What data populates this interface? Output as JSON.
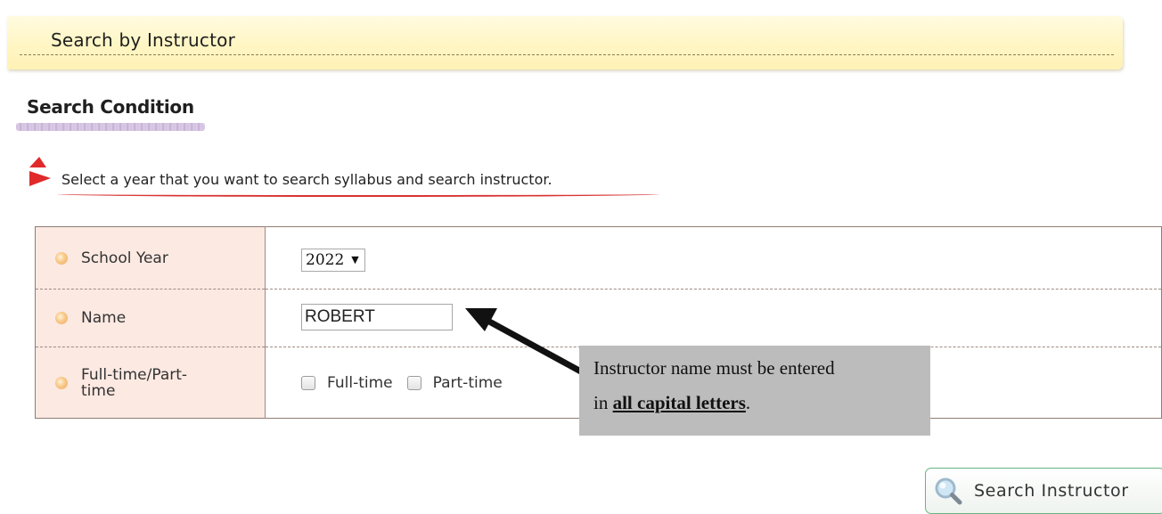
{
  "header": {
    "title": "Search by Instructor"
  },
  "section": {
    "title": "Search Condition"
  },
  "instruction": "Select a year that you want to search syllabus and search instructor.",
  "form": {
    "school_year": {
      "label": "School Year",
      "value": "2022"
    },
    "name": {
      "label": "Name",
      "value": "ROBERT"
    },
    "employment": {
      "label": "Full-time/Part-time",
      "options": [
        "Full-time",
        "Part-time"
      ]
    }
  },
  "callout": {
    "line1": "Instructor name must be entered",
    "line2_prefix": "in",
    "line2_bold": "all capital letters",
    "line2_suffix": "."
  },
  "search_button": {
    "label": "Search Instructor"
  },
  "colors": {
    "banner": "#fff6c4",
    "label_cell": "#fce9e2",
    "alert_red": "#e02a2a",
    "callout_bg": "#bcbcbc",
    "button_border": "#66b580"
  }
}
